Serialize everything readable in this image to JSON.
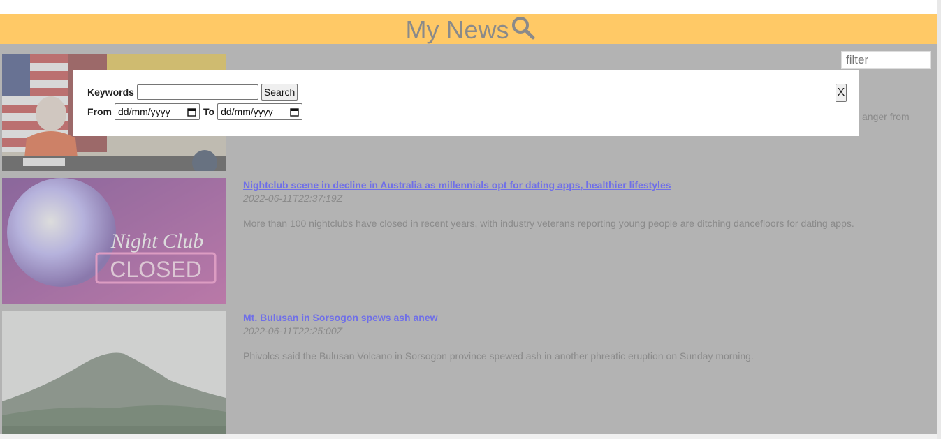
{
  "header": {
    "title": "My News"
  },
  "filter": {
    "placeholder": "filter"
  },
  "partial_desc": "anger from",
  "articles": [
    {
      "title": "Nightclub scene in decline in Australia as millennials opt for dating apps, healthier lifestyles",
      "date": "2022-06-11T22:37:19Z",
      "desc": "More than 100 nightclubs have closed in recent years, with industry veterans reporting young people are ditching dancefloors for dating apps.",
      "image_text_1": "Night Club",
      "image_text_2": "CLOSED"
    },
    {
      "title": "Mt. Bulusan in Sorsogon spews ash anew",
      "date": "2022-06-11T22:25:00Z",
      "desc": "Phivolcs said the Bulusan Volcano in Sorsogon province spewed ash in another phreatic eruption on Sunday morning."
    }
  ],
  "modal": {
    "keywords_label": "Keywords",
    "search_label": "Search",
    "from_label": "From",
    "to_label": "To",
    "from_placeholder": "dd/mm/yyyy",
    "to_placeholder": "dd/mm/yyyy",
    "close_label": "X"
  },
  "colors": {
    "header_bg": "#ffc966",
    "overlay": "#b3b3b3",
    "link": "#6f6fe8"
  }
}
